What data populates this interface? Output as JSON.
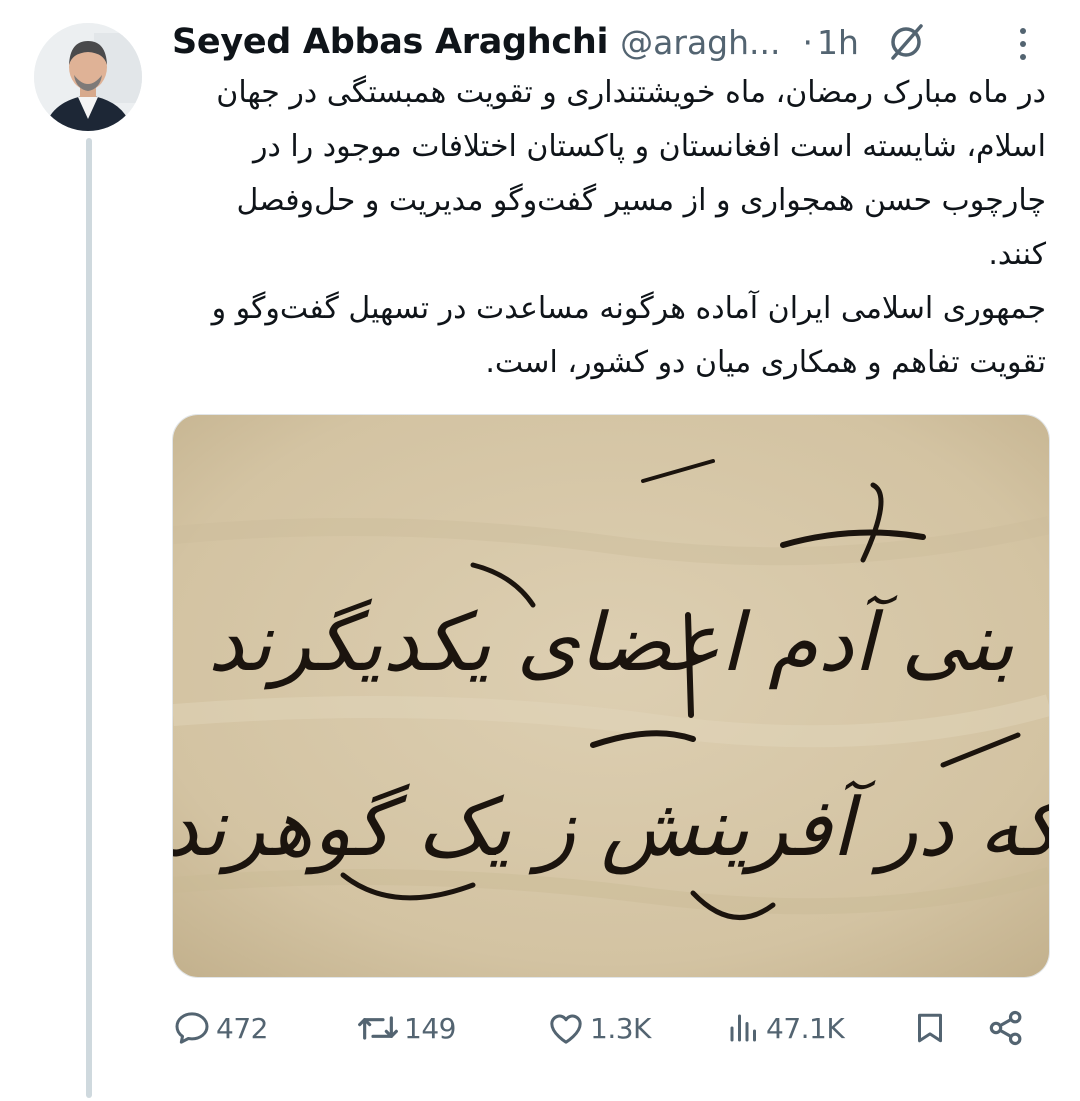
{
  "tweet": {
    "author_name": "Seyed Abbas Araghchi",
    "handle": "@aragh...",
    "separator": "·",
    "time": "1h",
    "paragraphs": [
      "در ماه مبارک رمضان، ماه خویشتنداری و تقویت همبستگی در جهان اسلام، شایسته است افغانستان و پاکستان اختلافات موجود را در چارچوب حسن همجواری و از مسیر گفت‌وگو مدیریت و حل‌وفصل کنند.",
      "جمهوری اسلامی ایران آماده هرگونه مساعدت در تسهیل گفت‌وگو و تقویت تفاهم و همکاری میان دو کشور، است."
    ],
    "image": {
      "calligraphy_lines": [
        "بنی آدم اعضای یکدیگرند",
        "که در آفرینش ز یک گوهرند"
      ],
      "background_color": "#d8c9aa",
      "ink_color": "#1b140e"
    }
  },
  "actions": {
    "reply_count": "472",
    "repost_count": "149",
    "like_count": "1.3K",
    "views_count": "47.1K"
  },
  "icons": {
    "grok": "slashed-circle-icon",
    "more": "vertical-ellipsis-icon",
    "reply": "speech-bubble-icon",
    "repost": "repost-arrows-icon",
    "like": "heart-icon",
    "views": "bar-chart-icon",
    "bookmark": "bookmark-icon",
    "share": "share-icon"
  },
  "colors": {
    "text_primary": "#0f1419",
    "text_secondary": "#536471",
    "thread_line": "#cfd9de"
  }
}
